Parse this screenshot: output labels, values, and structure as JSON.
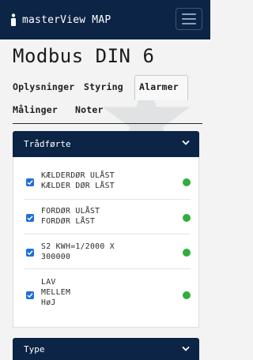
{
  "app": {
    "brand": "masterView MAP",
    "logo_icon": "person-icon",
    "menu_icon": "hamburger-menu-icon"
  },
  "page": {
    "title": "Modbus DIN 6"
  },
  "tabs": [
    {
      "label": "Oplysninger",
      "active": false
    },
    {
      "label": "Styring",
      "active": false
    },
    {
      "label": "Alarmer",
      "active": true
    },
    {
      "label": "Målinger",
      "active": false
    },
    {
      "label": "Noter",
      "active": false
    }
  ],
  "panels": [
    {
      "title": "Trådførte",
      "expanded": true,
      "items": [
        {
          "line1": "KÆLDERDØR ULÅST",
          "line2": "KÆLDER DØR LÅST",
          "line3": "",
          "checked": true,
          "status_color": "#2fae3b"
        },
        {
          "line1": "FORDØR ULÅST",
          "line2": "FORDØR LÅST",
          "line3": "",
          "checked": true,
          "status_color": "#2fae3b"
        },
        {
          "line1": "S2 KWH=1/2000 X",
          "line2": "300000",
          "line3": "",
          "checked": true,
          "status_color": "#2fae3b"
        },
        {
          "line1": "LAV",
          "line2": "MELLEM",
          "line3": "HøJ",
          "checked": true,
          "status_color": "#2fae3b"
        }
      ]
    },
    {
      "title": "Type",
      "expanded": false
    }
  ],
  "colors": {
    "navy": "#0c2445",
    "checkbox": "#1e6fd9",
    "status_ok": "#2fae3b"
  }
}
